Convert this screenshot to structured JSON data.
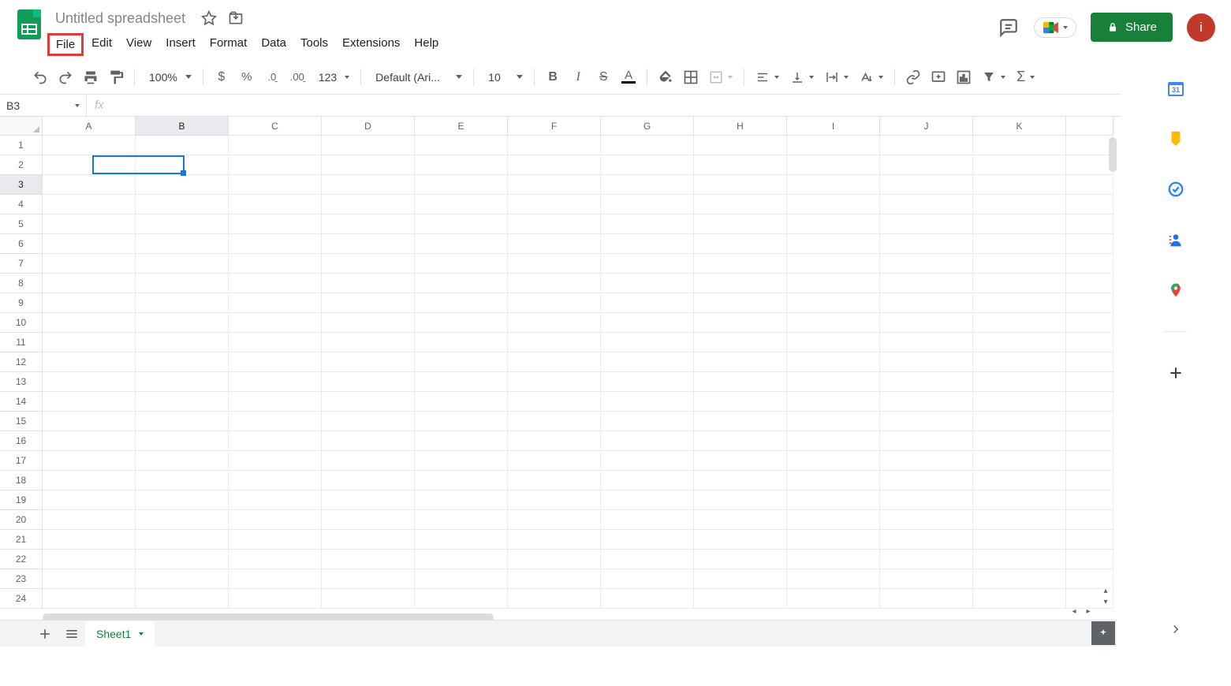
{
  "doc": {
    "title": "Untitled spreadsheet"
  },
  "menus": [
    "File",
    "Edit",
    "View",
    "Insert",
    "Format",
    "Data",
    "Tools",
    "Extensions",
    "Help"
  ],
  "highlighted_menu_index": 0,
  "header_right": {
    "share_label": "Share",
    "avatar_letter": "i"
  },
  "toolbar": {
    "zoom": "100%",
    "font": "Default (Ari...",
    "font_size": "10",
    "number_format": "123"
  },
  "formula": {
    "name_box": "B3",
    "value": ""
  },
  "grid": {
    "columns": [
      "A",
      "B",
      "C",
      "D",
      "E",
      "F",
      "G",
      "H",
      "I",
      "J",
      "K"
    ],
    "rows": [
      1,
      2,
      3,
      4,
      5,
      6,
      7,
      8,
      9,
      10,
      11,
      12,
      13,
      14,
      15,
      16,
      17,
      18,
      19,
      20,
      21,
      22,
      23,
      24
    ],
    "selected_col_index": 1,
    "selected_row_index": 2
  },
  "bottom": {
    "sheet_name": "Sheet1"
  },
  "side": {
    "calendar_day": "31"
  },
  "icons": {
    "star": "star-icon",
    "move": "move-icon",
    "comment": "comment-icon",
    "undo": "undo-icon",
    "redo": "redo-icon",
    "print": "print-icon",
    "paint": "paint-format-icon",
    "currency": "currency-icon",
    "percent": "percent-icon",
    "dec_dec": "decrease-decimal-icon",
    "inc_dec": "increase-decimal-icon",
    "bold": "bold-icon",
    "italic": "italic-icon",
    "strike": "strike-icon",
    "textcolor": "text-color-icon",
    "fill": "fill-color-icon",
    "borders": "borders-icon",
    "merge": "merge-icon",
    "halign": "h-align-icon",
    "valign": "v-align-icon",
    "wrap": "wrap-icon",
    "rotate": "rotate-icon",
    "link": "link-icon",
    "insert_comment": "insert-comment-icon",
    "chart": "chart-icon",
    "filter": "filter-icon",
    "functions": "functions-icon",
    "collapse": "collapse-icon"
  }
}
